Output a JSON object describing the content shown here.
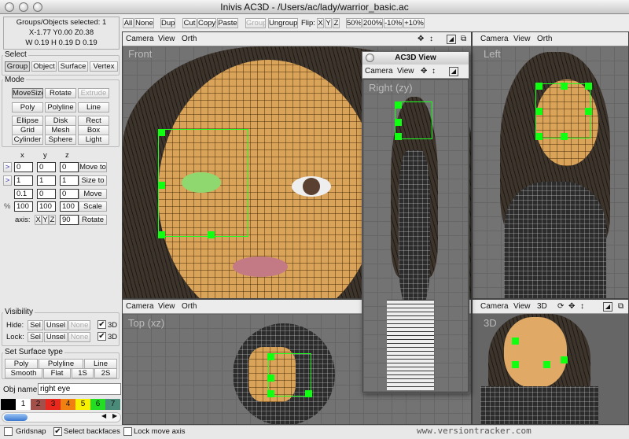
{
  "window": {
    "title": "Inivis AC3D - /Users/ac/lady/warrior_basic.ac"
  },
  "info": {
    "line1": "Groups/Objects selected: 1",
    "line2": "X-1.77 Y0.00 Z0.38",
    "line3": "W 0.19 H 0.19 D 0.19"
  },
  "select": {
    "label": "Select",
    "buttons": [
      "Group",
      "Object",
      "Surface",
      "Vertex"
    ]
  },
  "mode": {
    "label": "Mode",
    "buttons": [
      "MoveSize",
      "Rotate",
      "Extrude",
      "Poly",
      "Polyline",
      "Line",
      "Ellipse",
      "Disk",
      "Rect",
      "Grid",
      "Mesh",
      "Box",
      "Cylinder",
      "Sphere",
      "Light"
    ]
  },
  "transform": {
    "headers": [
      "x",
      "y",
      "z"
    ],
    "arrow": ">",
    "percent": "%",
    "axis_label": "axis:",
    "axis_buttons": [
      "X",
      "Y",
      "Z"
    ],
    "rows": [
      {
        "values": [
          "0",
          "0",
          "0"
        ],
        "action": "Move to"
      },
      {
        "values": [
          "1",
          "1",
          "1"
        ],
        "action": "Size to"
      },
      {
        "values": [
          "0.1",
          "0",
          "0"
        ],
        "action": "Move"
      },
      {
        "values": [
          "100",
          "100",
          "100"
        ],
        "action": "Scale"
      }
    ],
    "rotate_value": "90",
    "rotate_label": "Rotate"
  },
  "visibility": {
    "label": "Visibility",
    "hide": "Hide:",
    "lock": "Lock:",
    "sel": "Sel",
    "unsel": "Unsel",
    "none": "None",
    "three_d": "3D",
    "hide_3d": true,
    "lock_3d": true
  },
  "surface": {
    "label": "Set Surface type",
    "buttons": [
      "Poly",
      "Polyline",
      "Line",
      "Smooth",
      "Flat",
      "1S",
      "2S"
    ]
  },
  "objname": {
    "label": "Obj name:",
    "value": "right eye"
  },
  "palette": {
    "labels": [
      "1",
      "2",
      "3",
      "4",
      "5",
      "6",
      "7"
    ],
    "colors": [
      "#000000",
      "#ffffff",
      "#a4504a",
      "#e8281c",
      "#f08010",
      "#f8f000",
      "#22dd22",
      "#4a8a78"
    ]
  },
  "bottom": {
    "gridsnap": "Gridsnap",
    "gridsnap_checked": false,
    "select_backfaces": "Select backfaces",
    "select_backfaces_checked": true,
    "lock_move_axis": "Lock move axis",
    "lock_move_axis_checked": false,
    "watermark": "www.versiontracker.com"
  },
  "toolbar": {
    "buttons": [
      "All",
      "None",
      "Dup",
      "Cut",
      "Copy",
      "Paste",
      "Group",
      "Ungroup"
    ],
    "flip": "Flip:",
    "flip_axes": [
      "X",
      "Y",
      "Z"
    ],
    "zoom": [
      "50%",
      "200%",
      "-10%",
      "+10%"
    ]
  },
  "viewports": {
    "front": {
      "menu": [
        "Camera",
        "View",
        "Orth"
      ],
      "title": "Front"
    },
    "left": {
      "menu": [
        "Camera",
        "View",
        "Orth"
      ],
      "title": "Left"
    },
    "top": {
      "menu": [
        "Camera",
        "View",
        "Orth"
      ],
      "title": "Top (xz)"
    },
    "threed": {
      "menu": [
        "Camera",
        "View",
        "3D"
      ],
      "title": "3D"
    },
    "floating": {
      "window_title": "AC3D View",
      "menu": [
        "Camera",
        "View"
      ],
      "title": "Right (zy)"
    }
  },
  "colors": {
    "selection": "#22ff22",
    "viewport_bg": "#737373",
    "skin": "#d9a45a"
  }
}
